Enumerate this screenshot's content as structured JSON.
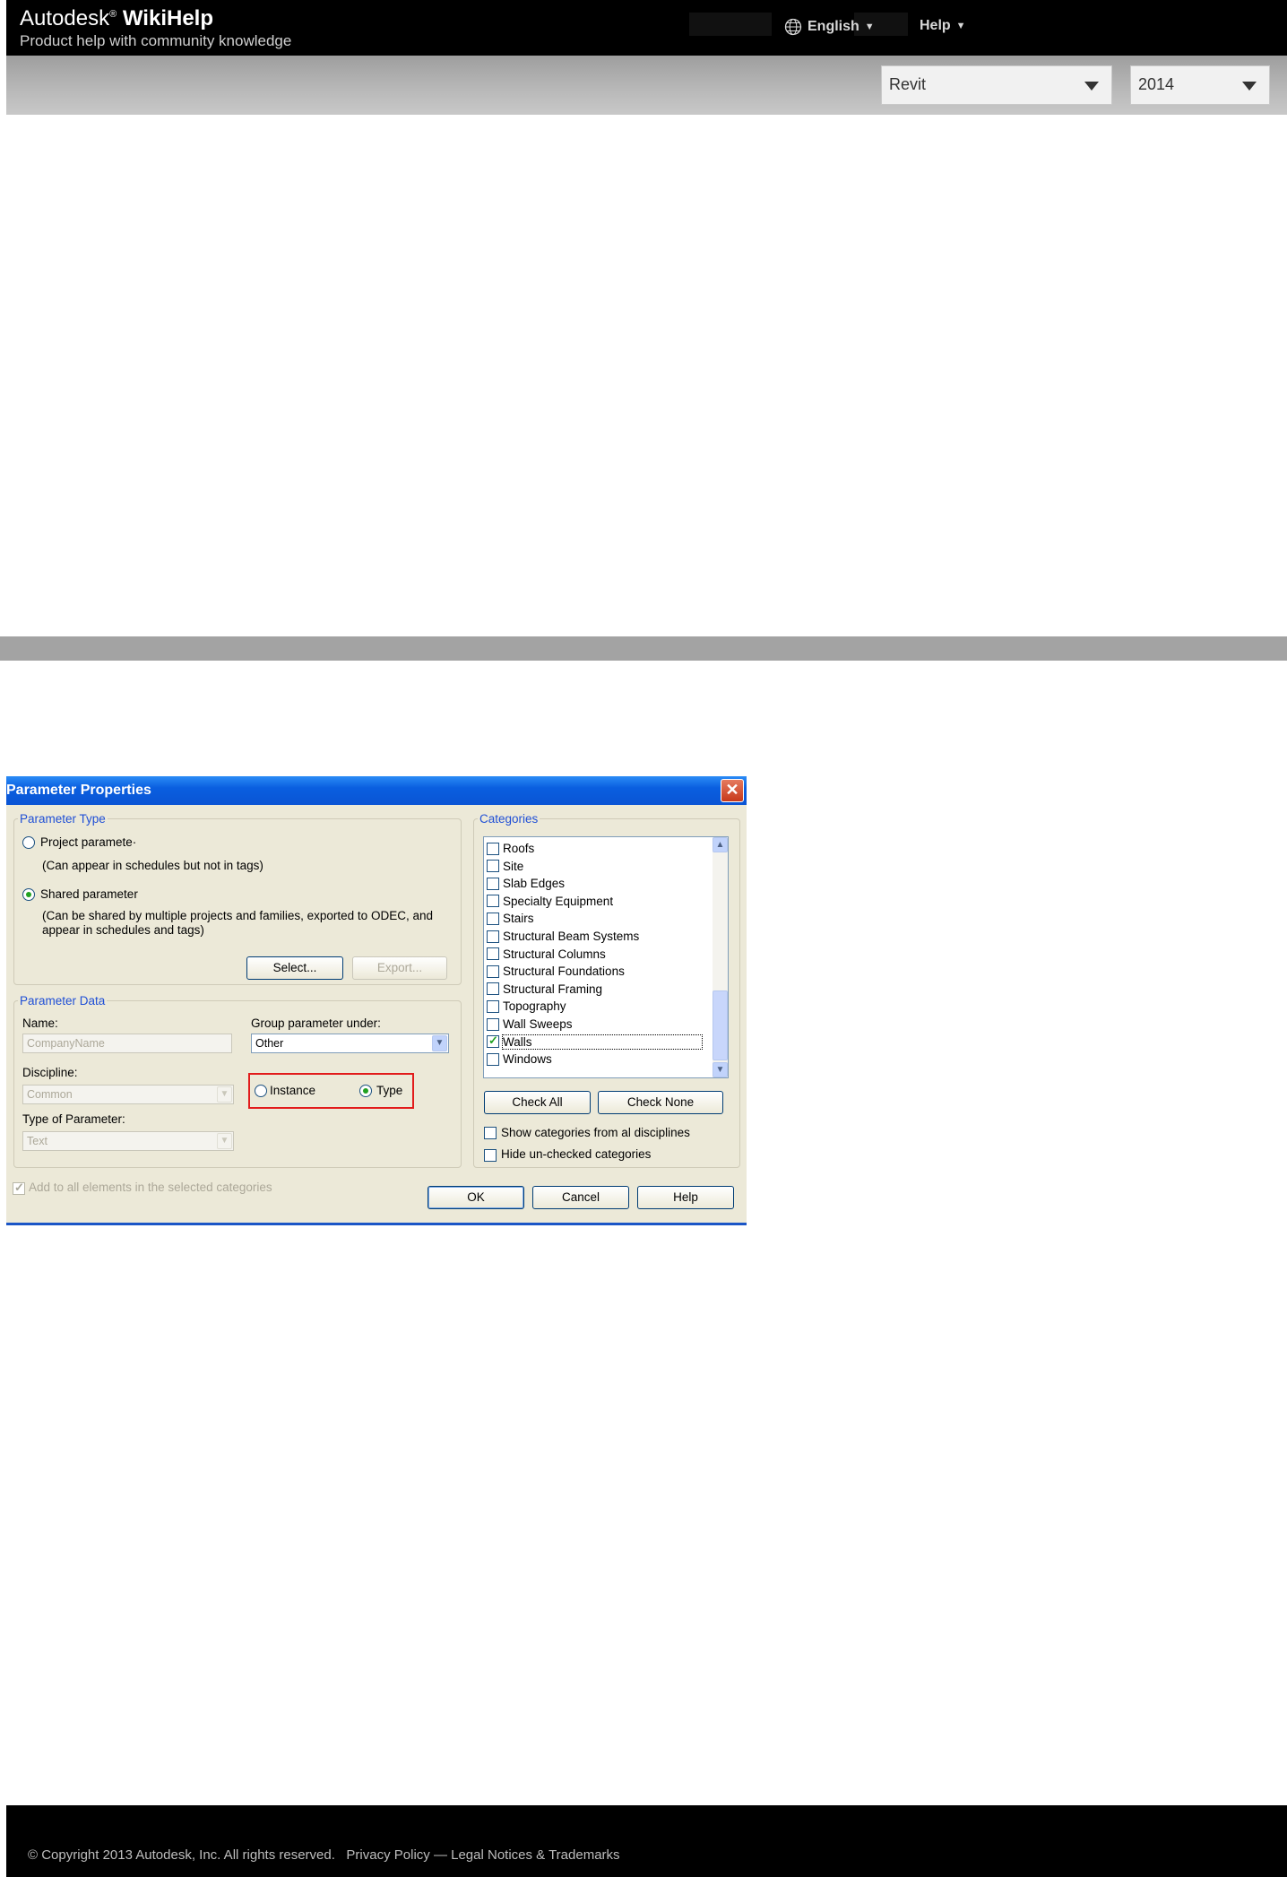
{
  "header": {
    "brand": "Autodesk",
    "brand_mark": "®",
    "product": "WikiHelp",
    "tagline": "Product help with community knowledge",
    "language": "English",
    "help": "Help",
    "product_select": "Revit",
    "version_select": "2014"
  },
  "dialog": {
    "title": "Parameter Properties",
    "close": "✕",
    "parameter_type": {
      "legend": "Parameter Type",
      "project_label": "Project paramete·",
      "project_desc": "(Can appear in schedules but not in tags)",
      "shared_label": "Shared parameter",
      "shared_desc_1": "(Can be shared by multiple projects and families, exported to ODEC, and",
      "shared_desc_2": "appear in schedules and tags)",
      "select_button": "Select...",
      "export_button": "Export..."
    },
    "parameter_data": {
      "legend": "Parameter Data",
      "name_label": "Name:",
      "name_value": "CompanyName",
      "group_label": "Group parameter under:",
      "group_value": "Other",
      "discipline_label": "Discipline:",
      "discipline_value": "Common",
      "instance_label": "Instance",
      "type_label": "Type",
      "type_of_param_label": "Type of Parameter:",
      "type_of_param_value": "Text"
    },
    "add_all_label": "Add to all elements in the selected categories",
    "categories": {
      "legend": "Categories",
      "items": [
        {
          "label": "Roofs",
          "checked": false
        },
        {
          "label": "Site",
          "checked": false
        },
        {
          "label": "Slab Edges",
          "checked": false
        },
        {
          "label": "Specialty Equipment",
          "checked": false
        },
        {
          "label": "Stairs",
          "checked": false
        },
        {
          "label": "Structural Beam Systems",
          "checked": false
        },
        {
          "label": "Structural Columns",
          "checked": false
        },
        {
          "label": "Structural Foundations",
          "checked": false
        },
        {
          "label": "Structural Framing",
          "checked": false
        },
        {
          "label": "Topography",
          "checked": false
        },
        {
          "label": "Wall Sweeps",
          "checked": false
        },
        {
          "label": "Walls",
          "checked": true
        },
        {
          "label": "Windows",
          "checked": false
        }
      ],
      "check_all": "Check All",
      "check_none": "Check None",
      "show_all_label": "Show categories from al disciplines",
      "hide_unchecked_label": "Hide un-checked categories"
    },
    "ok": "OK",
    "cancel": "Cancel",
    "help": "Help"
  },
  "footer": {
    "copyright": "© Copyright 2013 Autodesk, Inc. All rights reserved.",
    "privacy": "Privacy Policy",
    "separator": "—",
    "legal": "Legal Notices & Trademarks"
  }
}
